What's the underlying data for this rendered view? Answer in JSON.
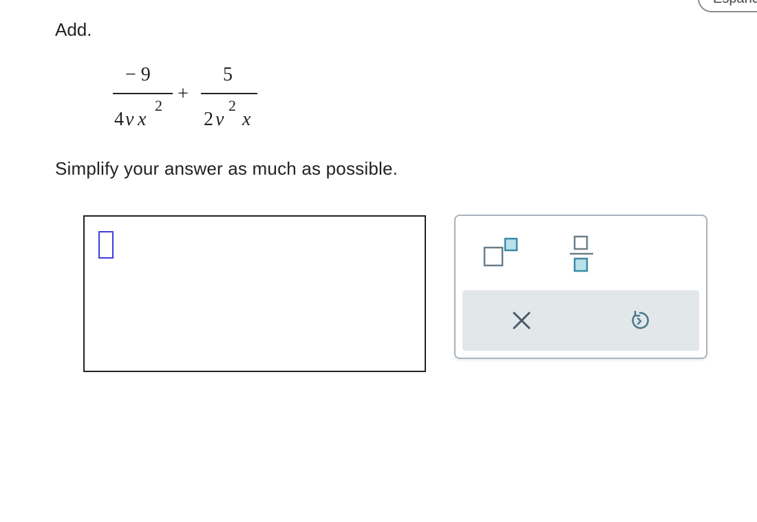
{
  "language_toggle": {
    "label": "Español"
  },
  "question": {
    "instruction": "Add.",
    "expression": {
      "first_fraction": {
        "numerator": "− 9",
        "denominator_coeff": "4",
        "denominator_v": "v",
        "denominator_x": "x",
        "denominator_exp": "2"
      },
      "operator": "+",
      "second_fraction": {
        "numerator": "5",
        "denominator_coeff": "2",
        "denominator_v": "v",
        "denominator_exp": "2",
        "denominator_x": "x"
      }
    },
    "simplify_instruction": "Simplify your answer as much as possible."
  },
  "palette": {
    "tools": [
      {
        "icon": "superscript-icon"
      },
      {
        "icon": "fraction-icon"
      }
    ],
    "actions": [
      {
        "icon": "clear-x-icon"
      },
      {
        "icon": "undo-icon"
      }
    ],
    "colors": {
      "icon_outline": "#6b7d88",
      "icon_fill": "#b9e1ec",
      "icon_accent": "#3a8aa3",
      "action_bar": "#e2e7ea",
      "cursor": "#3d3dd8"
    }
  }
}
